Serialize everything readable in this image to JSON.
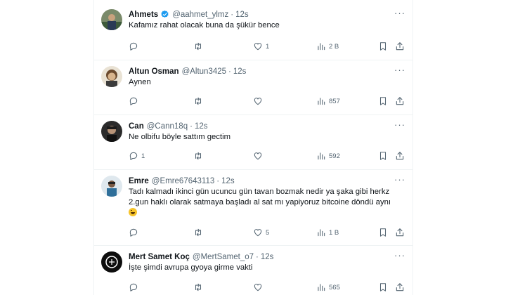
{
  "tweets": [
    {
      "name": "Ahmets",
      "verified": true,
      "handle": "@aahmet_ylmz",
      "time": "12s",
      "text": "Kafamız rahat olacak buna da şükür bence",
      "replies": "",
      "retweets": "",
      "likes": "1",
      "views": "2 B"
    },
    {
      "name": "Altun Osman",
      "verified": false,
      "handle": "@Altun3425",
      "time": "12s",
      "text": "Aynen",
      "replies": "",
      "retweets": "",
      "likes": "",
      "views": "857"
    },
    {
      "name": "Can",
      "verified": false,
      "handle": "@Cann18q",
      "time": "12s",
      "text": "Ne olbifu böyle sattım gectim",
      "replies": "1",
      "retweets": "",
      "likes": "",
      "views": "592"
    },
    {
      "name": "Emre",
      "verified": false,
      "handle": "@Emre67643113",
      "time": "12s",
      "text": "Tadı kalmadı ikinci gün ucuncu gün tavan bozmak nedir ya şaka gibi herkz 2.gun haklı olarak satmaya başladı al sat mı yapiyoruz bitcoine döndü aynı",
      "replies": "",
      "retweets": "",
      "likes": "5",
      "views": "1 B"
    },
    {
      "name": "Mert Samet Koç",
      "verified": false,
      "handle": "@MertSamet_o7",
      "time": "12s",
      "text": "İşte şimdi avrupa gyoya girme vakti",
      "replies": "",
      "retweets": "",
      "likes": "",
      "views": "565"
    }
  ],
  "separator": "·",
  "colors": {
    "text": "#0f1419",
    "secondary": "#536471",
    "verified": "#1d9bf0",
    "border": "#eff3f4"
  },
  "icons": [
    "reply-icon",
    "retweet-icon",
    "like-icon",
    "views-icon",
    "bookmark-icon",
    "share-icon",
    "more-icon",
    "verified-badge-icon",
    "laughing-emoji-icon"
  ]
}
